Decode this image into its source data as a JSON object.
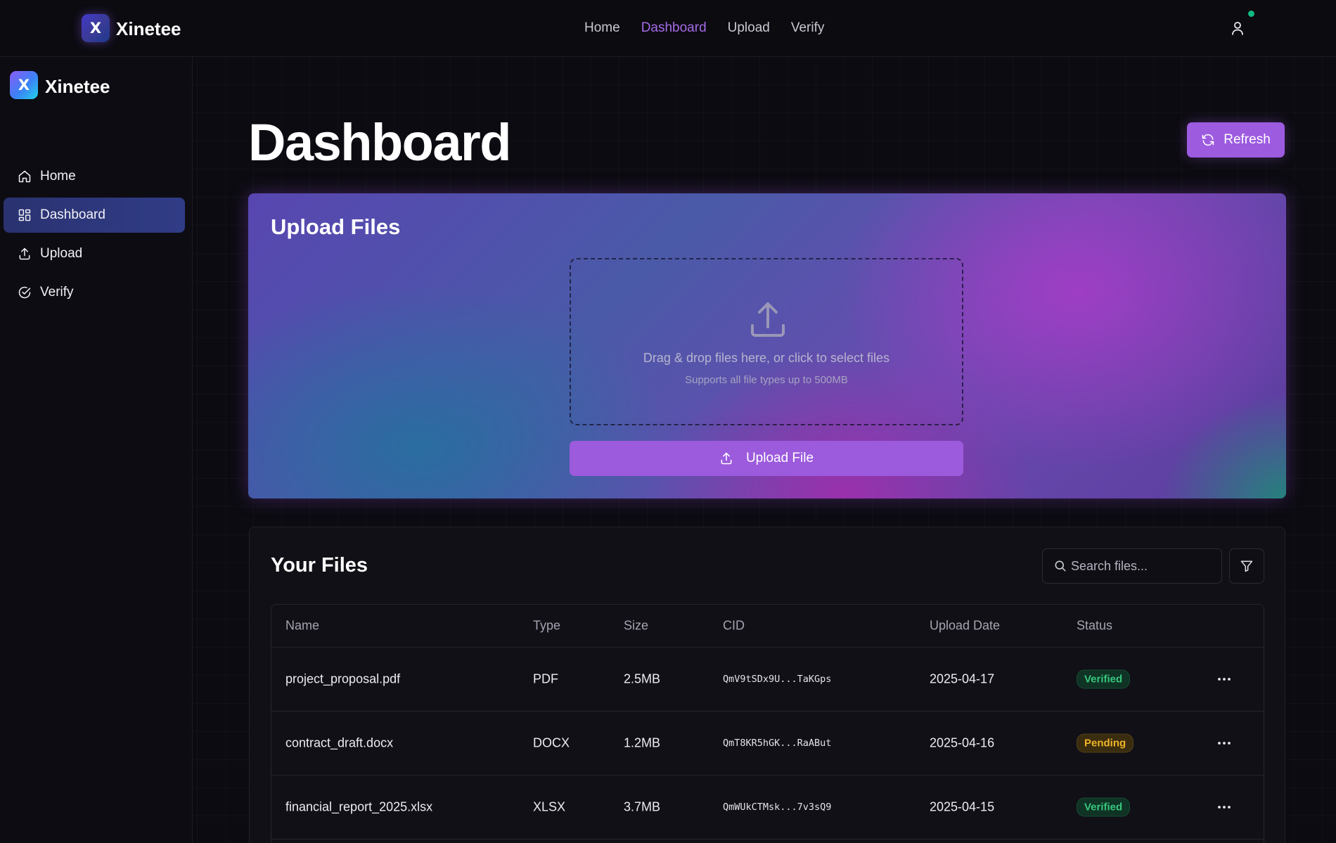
{
  "app": {
    "logo_letter": "X",
    "brand": "Xinetee"
  },
  "topnav": {
    "items": [
      {
        "label": "Home",
        "active": false
      },
      {
        "label": "Dashboard",
        "active": true
      },
      {
        "label": "Upload",
        "active": false
      },
      {
        "label": "Verify",
        "active": false
      }
    ],
    "user_icon": "user-icon",
    "status_dot_color": "#10b981"
  },
  "sidebar": {
    "logo_letter": "X",
    "brand": "Xinetee",
    "items": [
      {
        "label": "Home",
        "icon": "home-icon",
        "active": false
      },
      {
        "label": "Dashboard",
        "icon": "grid-icon",
        "active": true
      },
      {
        "label": "Upload",
        "icon": "upload-icon",
        "active": false
      },
      {
        "label": "Verify",
        "icon": "check-circle-icon",
        "active": false
      }
    ]
  },
  "main": {
    "title": "Dashboard",
    "refresh_label": "Refresh",
    "accent_color": "#9d5be0"
  },
  "upload": {
    "title": "Upload Files",
    "dropzone_text": "Drag & drop files here, or click to select files",
    "dropzone_subtext": "Supports all file types up to 500MB",
    "button_label": "Upload File"
  },
  "files": {
    "title": "Your Files",
    "search_placeholder": "Search files...",
    "columns": [
      "Name",
      "Type",
      "Size",
      "CID",
      "Upload Date",
      "Status"
    ],
    "rows": [
      {
        "name": "project_proposal.pdf",
        "type": "PDF",
        "size": "2.5MB",
        "cid": "QmV9tSDx9U...TaKGps",
        "date": "2025-04-17",
        "status": "Verified"
      },
      {
        "name": "contract_draft.docx",
        "type": "DOCX",
        "size": "1.2MB",
        "cid": "QmT8KR5hGK...RaABut",
        "date": "2025-04-16",
        "status": "Pending"
      },
      {
        "name": "financial_report_2025.xlsx",
        "type": "XLSX",
        "size": "3.7MB",
        "cid": "QmWUkCTMsk...7v3sQ9",
        "date": "2025-04-15",
        "status": "Verified"
      }
    ]
  }
}
